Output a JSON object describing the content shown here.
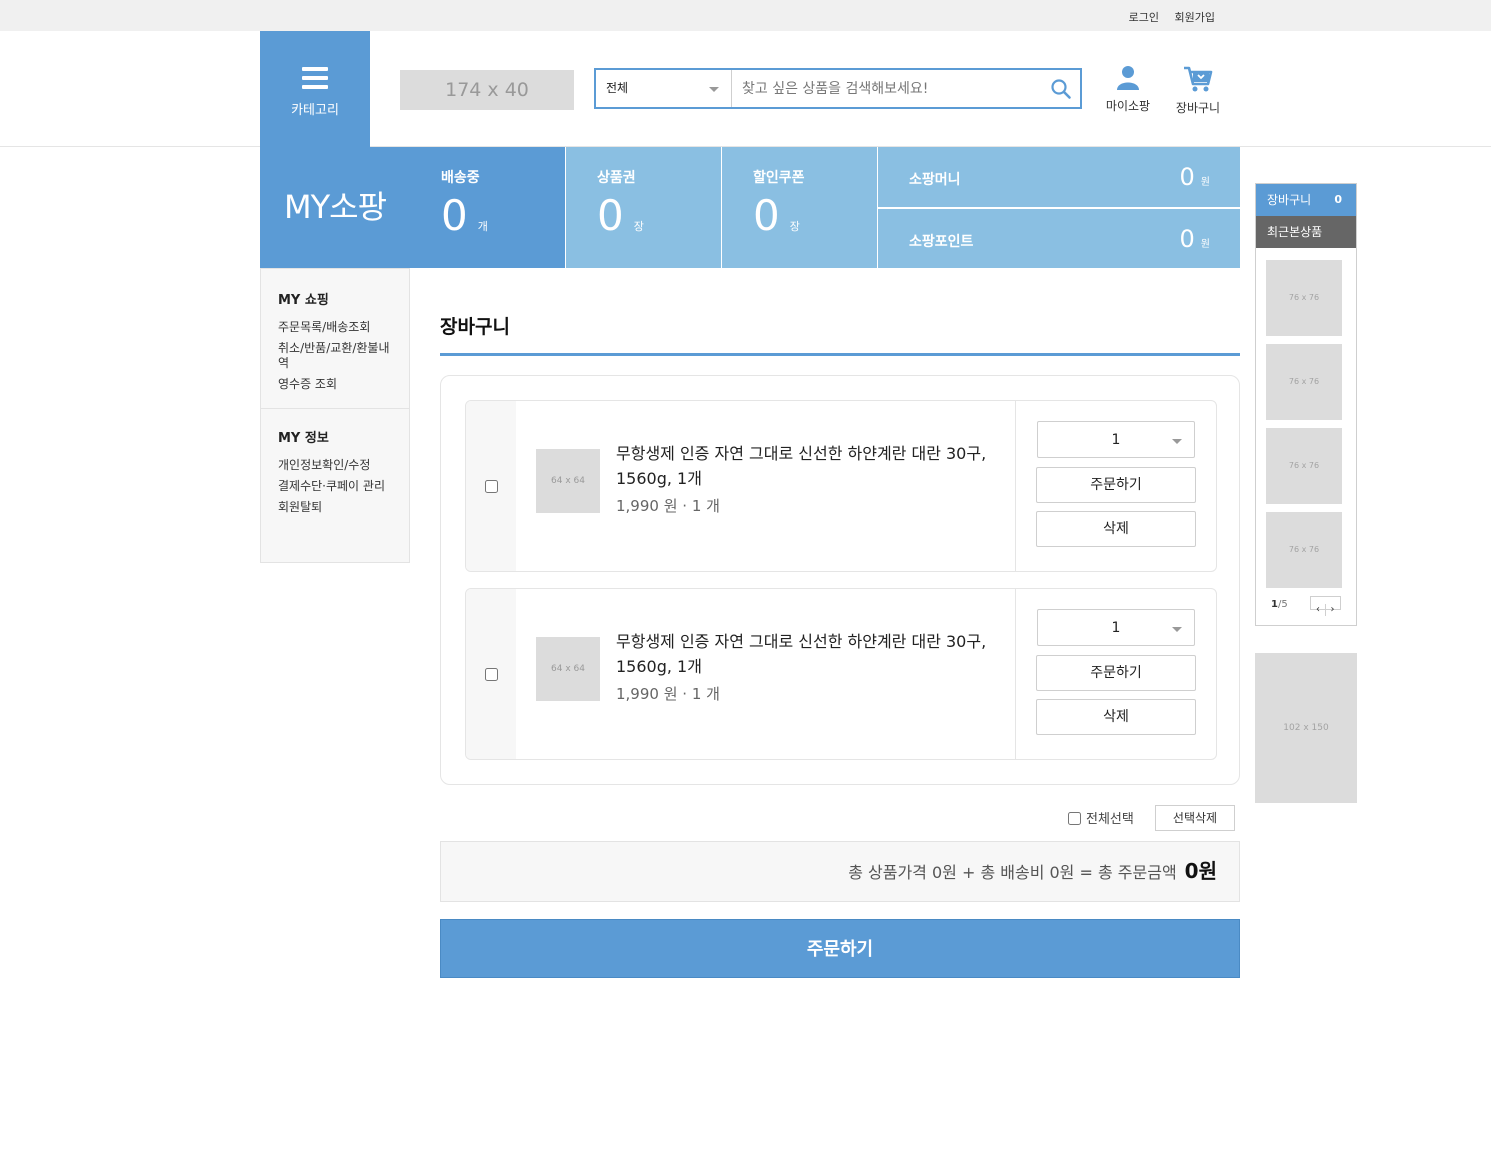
{
  "top_links": {
    "login": "로그인",
    "signup": "회원가입"
  },
  "header": {
    "category_label": "카테고리",
    "logo_placeholder": "174 x 40",
    "search": {
      "category": "전체",
      "placeholder": "찾고 싶은 상품을 검색해보세요!"
    },
    "my_label": "마이소팡",
    "cart_label": "장바구니"
  },
  "mybar": {
    "title": "MY소팡",
    "shipping": {
      "label": "배송중",
      "value": "0",
      "unit": "개"
    },
    "giftcard": {
      "label": "상품권",
      "value": "0",
      "unit": "장"
    },
    "coupon": {
      "label": "할인쿠폰",
      "value": "0",
      "unit": "장"
    },
    "money": {
      "label": "소팡머니",
      "value": "0",
      "unit": "원"
    },
    "points": {
      "label": "소팡포인트",
      "value": "0",
      "unit": "원"
    }
  },
  "sidebar": {
    "shopping": {
      "title": "MY 쇼핑",
      "items": [
        "주문목록/배송조회",
        "취소/반품/교환/환불내역",
        "영수증 조회"
      ]
    },
    "info": {
      "title": "MY 정보",
      "items": [
        "개인정보확인/수정",
        "결제수단·쿠페이 관리",
        "회원탈퇴"
      ]
    }
  },
  "main": {
    "title": "장바구니",
    "items": [
      {
        "thumb": "64 x 64",
        "name": "무항생제 인증 자연 그대로 신선한 하얀계란 대란 30구, 1560g, 1개",
        "price": "1,990 원 · 1 개",
        "qty": "1",
        "order_label": "주문하기",
        "delete_label": "삭제"
      },
      {
        "thumb": "64 x 64",
        "name": "무항생제 인증 자연 그대로 신선한 하얀계란 대란 30구, 1560g, 1개",
        "price": "1,990 원 · 1 개",
        "qty": "1",
        "order_label": "주문하기",
        "delete_label": "삭제"
      }
    ],
    "select_all": "전체선택",
    "delete_selected": "선택삭제",
    "total_text": "총 상품가격 0원 + 총 배송비 0원 = 총 주문금액",
    "total_amount": "0원",
    "order_button": "주문하기"
  },
  "right_sidebar": {
    "cart_label": "장바구니",
    "cart_count": "0",
    "recent_label": "최근본상품",
    "thumbs": [
      "76 x 76",
      "76 x 76",
      "76 x 76",
      "76 x 76"
    ],
    "page_current": "1",
    "page_total": "/5",
    "prev": "‹",
    "next": "›",
    "banner": "102 x 150"
  },
  "colors": {
    "accent": "#5b9bd5",
    "accent_light": "#8abfe2",
    "gray_bar": "#666666"
  }
}
